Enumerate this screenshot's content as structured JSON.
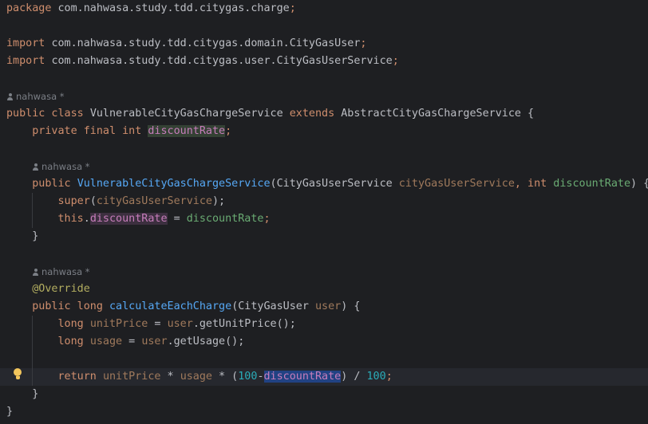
{
  "editor": {
    "theme": "dark",
    "current_line_index": 21,
    "lines": [
      {
        "kind": "code",
        "tokens": [
          {
            "t": "package ",
            "c": "kw"
          },
          {
            "t": "com.nahwasa.study.tdd.citygas.charge",
            "c": "grey"
          },
          {
            "t": ";",
            "c": "kw"
          }
        ]
      },
      {
        "kind": "code",
        "tokens": []
      },
      {
        "kind": "code",
        "tokens": [
          {
            "t": "import ",
            "c": "kw"
          },
          {
            "t": "com.nahwasa.study.tdd.citygas.domain.CityGasUser",
            "c": "grey"
          },
          {
            "t": ";",
            "c": "kw"
          }
        ]
      },
      {
        "kind": "code",
        "tokens": [
          {
            "t": "import ",
            "c": "kw"
          },
          {
            "t": "com.nahwasa.study.tdd.citygas.user.CityGasUserService",
            "c": "grey"
          },
          {
            "t": ";",
            "c": "kw"
          }
        ]
      },
      {
        "kind": "code",
        "tokens": []
      },
      {
        "kind": "hint",
        "indent": 0,
        "text": "nahwasa *"
      },
      {
        "kind": "code",
        "tokens": [
          {
            "t": "public class ",
            "c": "kw"
          },
          {
            "t": "VulnerableCityGasChargeService ",
            "c": "grey"
          },
          {
            "t": "extends ",
            "c": "kw"
          },
          {
            "t": "AbstractCityGasChargeService {",
            "c": "grey"
          }
        ]
      },
      {
        "kind": "code",
        "tokens": [
          {
            "t": "    private final int ",
            "c": "kw"
          },
          {
            "t": "discountRate",
            "c": "fieldhl"
          },
          {
            "t": ";",
            "c": "kw"
          }
        ]
      },
      {
        "kind": "code",
        "tokens": []
      },
      {
        "kind": "hint",
        "indent": 4,
        "text": "nahwasa *"
      },
      {
        "kind": "code",
        "tokens": [
          {
            "t": "    public ",
            "c": "kw"
          },
          {
            "t": "VulnerableCityGasChargeService",
            "c": "decl"
          },
          {
            "t": "(CityGasUserService ",
            "c": "grey"
          },
          {
            "t": "cityGasUserService",
            "c": "unused"
          },
          {
            "t": ", ",
            "c": "kw"
          },
          {
            "t": "int ",
            "c": "kw"
          },
          {
            "t": "discountRate",
            "c": "str"
          },
          {
            "t": ") {",
            "c": "grey"
          }
        ]
      },
      {
        "kind": "code",
        "tokens": [
          {
            "t": "        super",
            "c": "kw"
          },
          {
            "t": "(",
            "c": "grey"
          },
          {
            "t": "cityGasUserService",
            "c": "unused"
          },
          {
            "t": ");",
            "c": "grey"
          }
        ]
      },
      {
        "kind": "code",
        "tokens": [
          {
            "t": "        this",
            "c": "kw"
          },
          {
            "t": ".",
            "c": "grey"
          },
          {
            "t": "discountRate",
            "c": "fieldhl2"
          },
          {
            "t": " = ",
            "c": "grey"
          },
          {
            "t": "discountRate",
            "c": "str"
          },
          {
            "t": ";",
            "c": "kw"
          }
        ]
      },
      {
        "kind": "code",
        "tokens": [
          {
            "t": "    }",
            "c": "grey"
          }
        ]
      },
      {
        "kind": "code",
        "tokens": []
      },
      {
        "kind": "hint",
        "indent": 4,
        "text": "nahwasa *"
      },
      {
        "kind": "code",
        "tokens": [
          {
            "t": "    @Override",
            "c": "ann"
          }
        ]
      },
      {
        "kind": "code",
        "tokens": [
          {
            "t": "    public long ",
            "c": "kw"
          },
          {
            "t": "calculateEachCharge",
            "c": "decl"
          },
          {
            "t": "(CityGasUser ",
            "c": "grey"
          },
          {
            "t": "user",
            "c": "unused"
          },
          {
            "t": ") {",
            "c": "grey"
          }
        ]
      },
      {
        "kind": "code",
        "tokens": [
          {
            "t": "        long ",
            "c": "kw"
          },
          {
            "t": "unitPrice",
            "c": "unused"
          },
          {
            "t": " = ",
            "c": "grey"
          },
          {
            "t": "user",
            "c": "unused"
          },
          {
            "t": ".getUnitPrice();",
            "c": "grey"
          }
        ]
      },
      {
        "kind": "code",
        "tokens": [
          {
            "t": "        long ",
            "c": "kw"
          },
          {
            "t": "usage",
            "c": "unused"
          },
          {
            "t": " = ",
            "c": "grey"
          },
          {
            "t": "user",
            "c": "unused"
          },
          {
            "t": ".getUsage();",
            "c": "grey"
          }
        ]
      },
      {
        "kind": "code",
        "tokens": []
      },
      {
        "kind": "code",
        "tokens": [
          {
            "t": "        return ",
            "c": "kw"
          },
          {
            "t": "unitPrice",
            "c": "unused"
          },
          {
            "t": " * ",
            "c": "grey"
          },
          {
            "t": "usage",
            "c": "unused"
          },
          {
            "t": " * (",
            "c": "grey"
          },
          {
            "t": "100",
            "c": "num"
          },
          {
            "t": "-",
            "c": "grey"
          },
          {
            "t": "discountRate",
            "c": "sel"
          },
          {
            "t": ") / ",
            "c": "grey"
          },
          {
            "t": "100",
            "c": "num"
          },
          {
            "t": ";",
            "c": "kw"
          }
        ]
      },
      {
        "kind": "code",
        "tokens": [
          {
            "t": "    }",
            "c": "grey"
          }
        ]
      },
      {
        "kind": "code",
        "tokens": [
          {
            "t": "}",
            "c": "grey"
          }
        ]
      }
    ]
  },
  "icons": {
    "intention_bulb": "lightbulb-icon",
    "author_hint": "person-icon"
  }
}
